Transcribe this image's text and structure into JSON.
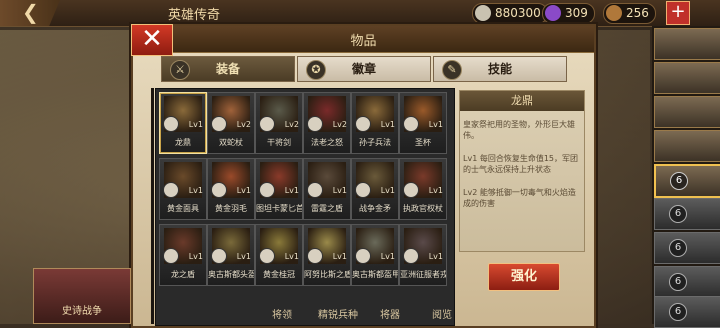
{
  "topbar": {
    "back_icon": "back-arrow-icon",
    "title": "英雄传奇",
    "resources": [
      {
        "name": "silver",
        "value": "880300",
        "icon": "silver-coin-icon",
        "color": "#c9c2b0"
      },
      {
        "name": "gem",
        "value": "309",
        "icon": "purple-gem-icon",
        "color": "#8a4ac8"
      },
      {
        "name": "food",
        "value": "256",
        "icon": "food-crate-icon",
        "color": "#b0783a"
      }
    ],
    "add_label": "+"
  },
  "panel": {
    "title": "物品",
    "close_label": "✕",
    "tabs": [
      {
        "label": "装备",
        "active": true,
        "icon": "helmet-icon"
      },
      {
        "label": "徽章",
        "active": false,
        "icon": "badge-icon"
      },
      {
        "label": "技能",
        "active": false,
        "icon": "scroll-icon"
      }
    ],
    "items": [
      {
        "name": "龙鼎",
        "level": "Lv1",
        "selected": true
      },
      {
        "name": "双蛇杖",
        "level": "Lv2"
      },
      {
        "name": "干将剑",
        "level": "Lv2"
      },
      {
        "name": "法老之怒",
        "level": "Lv2"
      },
      {
        "name": "孙子兵法",
        "level": "Lv1"
      },
      {
        "name": "圣杯",
        "level": "Lv1"
      },
      {
        "name": "黄金面具",
        "level": "Lv1"
      },
      {
        "name": "黄金羽毛",
        "level": "Lv1"
      },
      {
        "name": "图坦卡蒙匕首",
        "level": "Lv1"
      },
      {
        "name": "雷霆之盾",
        "level": "Lv1"
      },
      {
        "name": "战争金矛",
        "level": "Lv1"
      },
      {
        "name": "执政官权杖",
        "level": "Lv1"
      },
      {
        "name": "龙之盾",
        "level": "Lv1"
      },
      {
        "name": "奥古斯都头盔",
        "level": "Lv1"
      },
      {
        "name": "黄金桂冠",
        "level": "Lv1"
      },
      {
        "name": "阿努比斯之盾",
        "level": "Lv1"
      },
      {
        "name": "奥古斯都盔甲",
        "level": "Lv1"
      },
      {
        "name": "亚洲征服者戎装",
        "level": "Lv1"
      }
    ],
    "detail": {
      "title": "龙鼎",
      "description": "皇家祭祀用的圣物，外形巨大雄伟。",
      "effect1": "Lv1 每回合恢复生命值15，军团的士气永远保持上升状态",
      "effect2": "Lv2 能够抵御一切毒气和火焰造成的伤害"
    },
    "enhance_label": "强化"
  },
  "event": {
    "label": "史诗战争"
  },
  "bottom_nav": [
    "将领",
    "精锐兵种",
    "将器",
    "阅览"
  ],
  "buildings": [
    {
      "level": "",
      "dim": false
    },
    {
      "level": "",
      "dim": false
    },
    {
      "level": "",
      "dim": false
    },
    {
      "level": "",
      "dim": false
    },
    {
      "level": "6",
      "dim": false
    },
    {
      "level": "6",
      "dim": true
    },
    {
      "level": "6",
      "dim": true
    },
    {
      "level": "6",
      "dim": true
    },
    {
      "level": "6",
      "dim": true
    }
  ]
}
